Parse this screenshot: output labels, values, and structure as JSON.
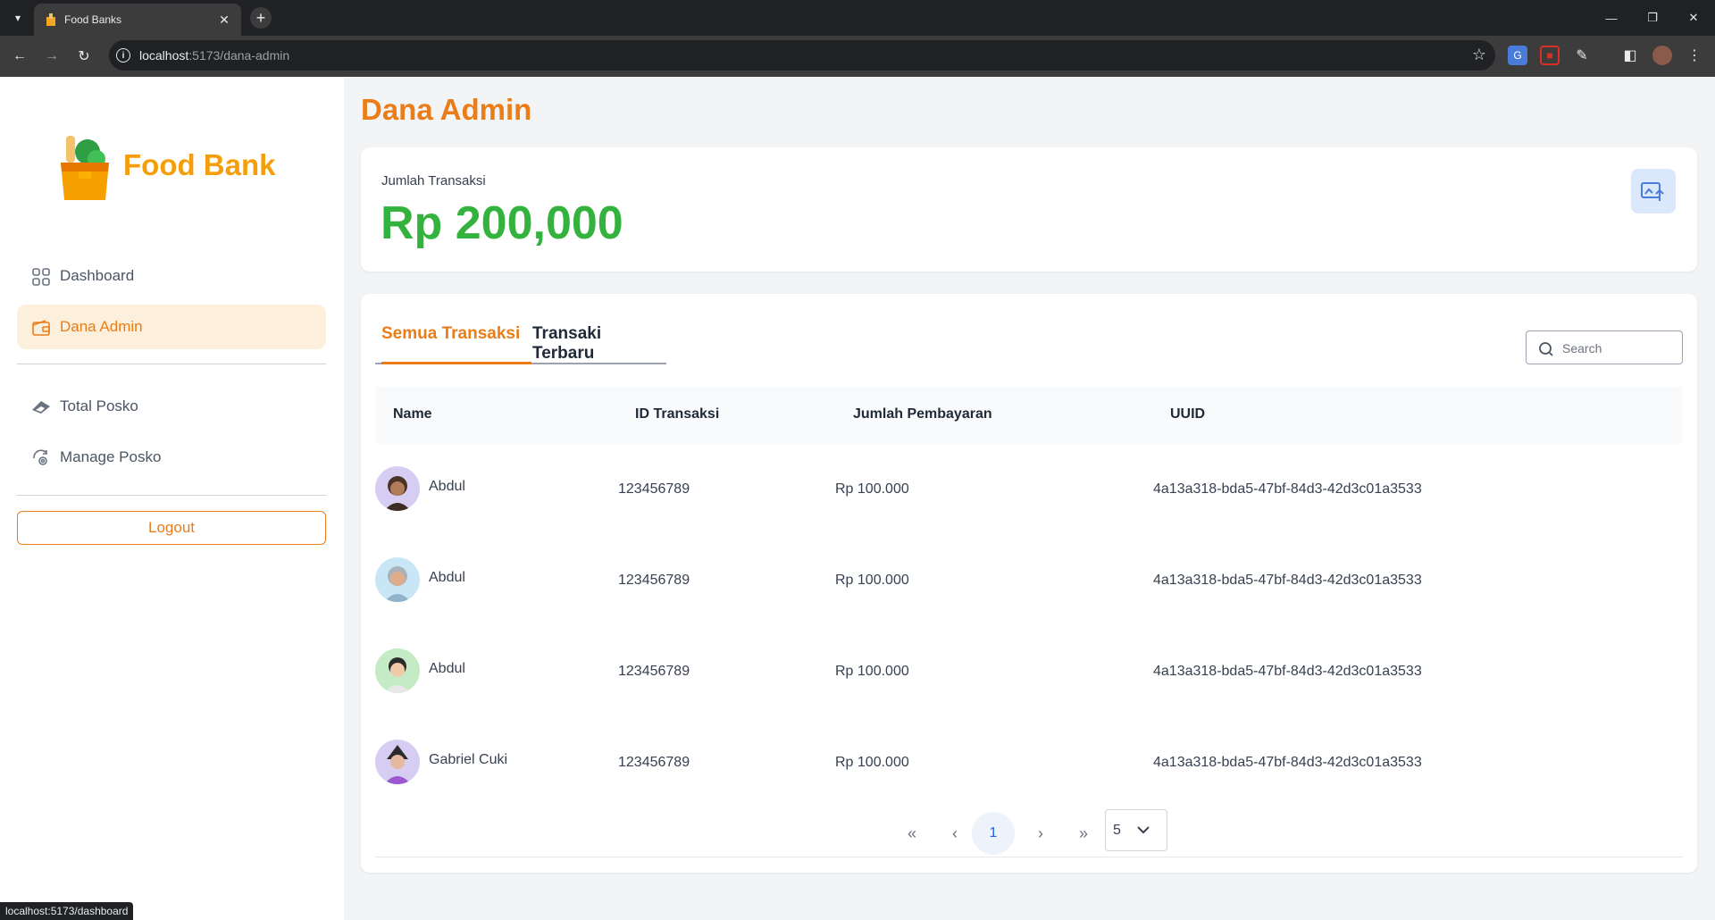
{
  "browser": {
    "tab_title": "Food Banks",
    "url_host": "localhost",
    "url_rest": ":5173/dana-admin",
    "status_url": "localhost:5173/dashboard"
  },
  "sidebar": {
    "logo_text": "Food Bank",
    "items": [
      {
        "label": "Dashboard",
        "icon": "grid-icon",
        "active": false
      },
      {
        "label": "Dana Admin",
        "icon": "wallet-icon",
        "active": true
      },
      {
        "label": "Total Posko",
        "icon": "tent-icon",
        "active": false
      },
      {
        "label": "Manage Posko",
        "icon": "manage-icon",
        "active": false
      }
    ],
    "logout_label": "Logout"
  },
  "page": {
    "title": "Dana Admin"
  },
  "summary": {
    "label": "Jumlah Transaksi",
    "value": "Rp 200,000"
  },
  "tabs": [
    {
      "label": "Semua Transaksi",
      "active": true
    },
    {
      "label": "Transaki Terbaru",
      "active": false
    }
  ],
  "search": {
    "placeholder": "Search",
    "value": ""
  },
  "table": {
    "headers": [
      "Name",
      "ID Transaksi",
      "Jumlah Pembayaran",
      "UUID"
    ],
    "rows": [
      {
        "name": "Abdul",
        "id": "123456789",
        "amount": "Rp 100.000",
        "uuid": "4a13a318-bda5-47bf-84d3-42d3c01a3533"
      },
      {
        "name": "Abdul",
        "id": "123456789",
        "amount": "Rp 100.000",
        "uuid": "4a13a318-bda5-47bf-84d3-42d3c01a3533"
      },
      {
        "name": "Abdul",
        "id": "123456789",
        "amount": "Rp 100.000",
        "uuid": "4a13a318-bda5-47bf-84d3-42d3c01a3533"
      },
      {
        "name": "Gabriel Cuki",
        "id": "123456789",
        "amount": "Rp 100.000",
        "uuid": "4a13a318-bda5-47bf-84d3-42d3c01a3533"
      }
    ]
  },
  "pagination": {
    "current_page": "1",
    "page_size": "5"
  },
  "colors": {
    "accent": "#ea7d18",
    "success": "#33b33d",
    "logo": "#f59e0b"
  }
}
